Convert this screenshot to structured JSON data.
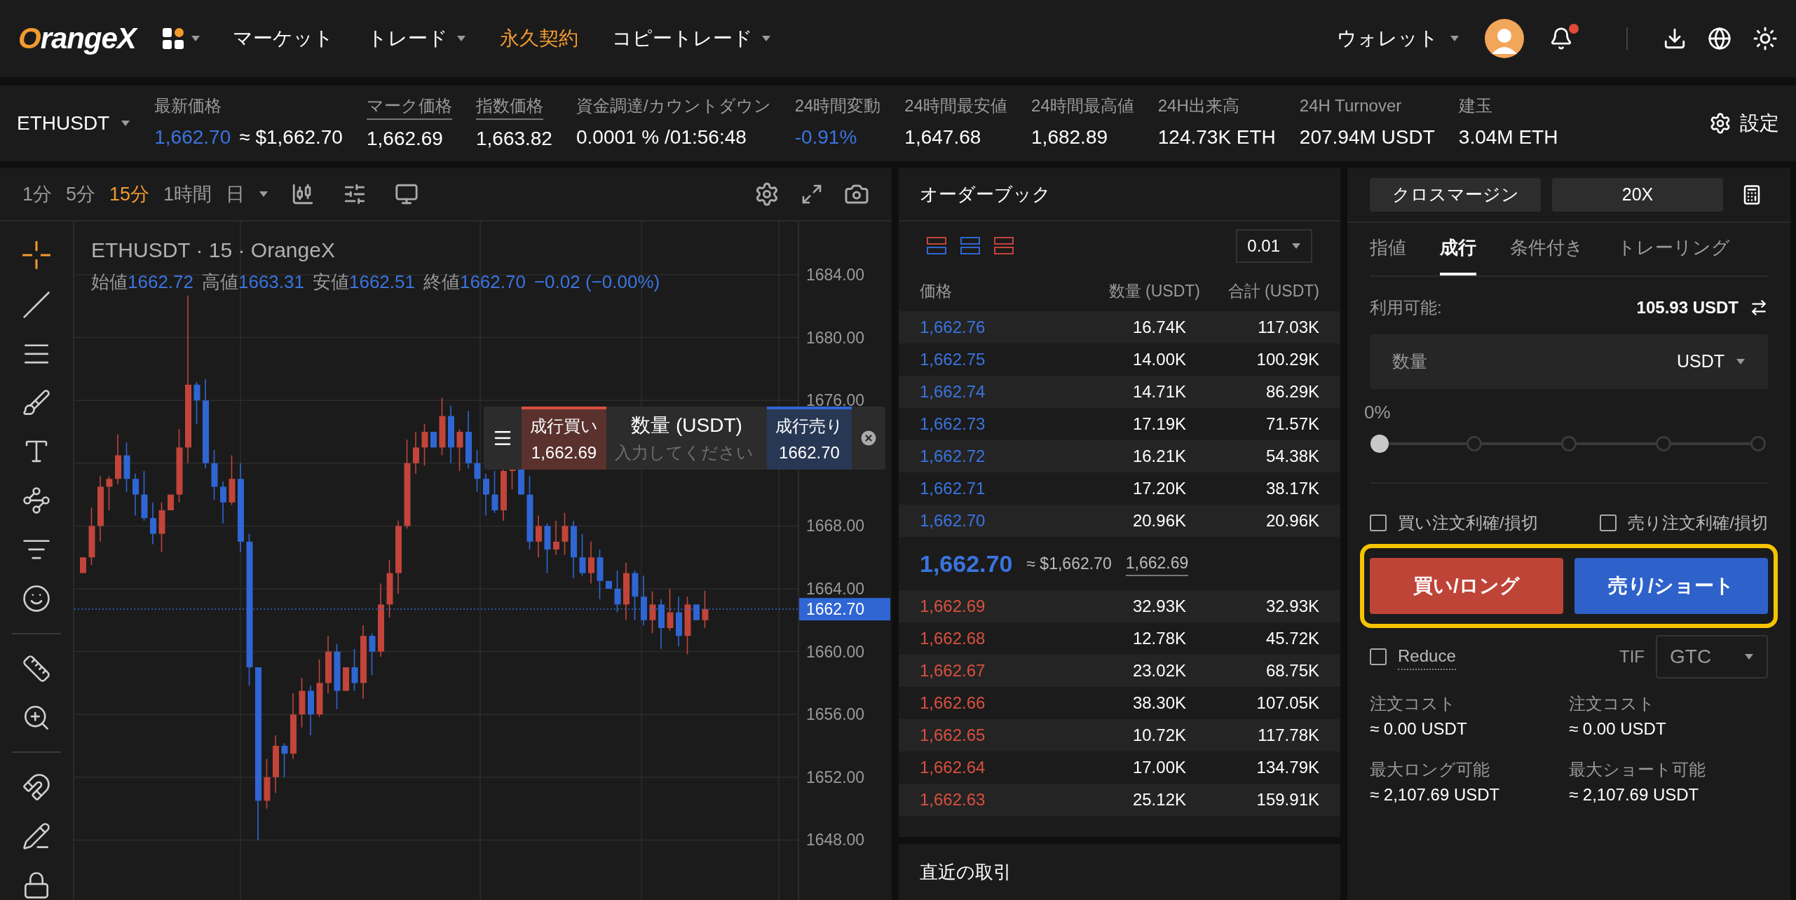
{
  "nav": {
    "logo": "OrangeX",
    "items": [
      {
        "label": "マーケット",
        "dropdown": false,
        "selected": false
      },
      {
        "label": "トレード",
        "dropdown": true,
        "selected": false
      },
      {
        "label": "永久契約",
        "dropdown": false,
        "selected": true
      },
      {
        "label": "コピートレード",
        "dropdown": true,
        "selected": false
      }
    ],
    "wallet": "ウォレット",
    "has_unread": true
  },
  "ticker": {
    "symbol": "ETHUSDT",
    "stats": [
      {
        "label": "最新価格",
        "value": "1,662.70",
        "extra": "≈ $1,662.70",
        "underlined": false,
        "negative": true
      },
      {
        "label": "マーク価格",
        "value": "1,662.69",
        "underlined": true,
        "negative": false
      },
      {
        "label": "指数価格",
        "value": "1,663.82",
        "underlined": true,
        "negative": false
      },
      {
        "label": "資金調達/カウントダウン",
        "value": "0.0001 % /01:56:48",
        "underlined": false,
        "negative": false
      },
      {
        "label": "24時間変動",
        "value": "-0.91%",
        "underlined": false,
        "negative": true
      },
      {
        "label": "24時間最安値",
        "value": "1,647.68",
        "underlined": false,
        "negative": false
      },
      {
        "label": "24時間最高値",
        "value": "1,682.89",
        "underlined": false,
        "negative": false
      },
      {
        "label": "24H出来高",
        "value": "124.73K ETH",
        "underlined": false,
        "negative": false
      },
      {
        "label": "24H Turnover",
        "value": "207.94M USDT",
        "underlined": false,
        "negative": false
      },
      {
        "label": "建玉",
        "value": "3.04M ETH",
        "underlined": false,
        "negative": false
      }
    ],
    "settings": "設定"
  },
  "chart": {
    "intervals": [
      {
        "label": "1分",
        "selected": false
      },
      {
        "label": "5分",
        "selected": false
      },
      {
        "label": "15分",
        "selected": true
      },
      {
        "label": "1時間",
        "selected": false
      },
      {
        "label": "日",
        "selected": false
      }
    ],
    "legend_title": "ETHUSDT · 15 · OrangeX",
    "ohlc": [
      {
        "label": "始値",
        "value": "1662.72"
      },
      {
        "label": "高値",
        "value": "1663.31"
      },
      {
        "label": "安値",
        "value": "1662.51"
      },
      {
        "label": "終値",
        "value": "1662.70"
      }
    ],
    "change": "−0.02 (−0.00%)",
    "price_ticks": [
      "1684.00",
      "1680.00",
      "1676.00",
      "1668.00",
      "1664.00",
      "1660.00",
      "1656.00",
      "1652.00",
      "1648.00"
    ],
    "last_price": "1662.70",
    "quick_order": {
      "buy_label": "成行買い",
      "buy_price": "1,662.69",
      "amount_label": "数量 (USDT)",
      "placeholder": "入力してください",
      "sell_label": "成行売り",
      "sell_price": "1662.70"
    }
  },
  "orderbook": {
    "title": "オーダーブック",
    "precision": "0.01",
    "columns": [
      "価格",
      "数量 (USDT)",
      "合計 (USDT)"
    ],
    "asks": [
      {
        "price": "1,662.76",
        "qty": "16.74K",
        "total": "117.03K"
      },
      {
        "price": "1,662.75",
        "qty": "14.00K",
        "total": "100.29K"
      },
      {
        "price": "1,662.74",
        "qty": "14.71K",
        "total": "86.29K"
      },
      {
        "price": "1,662.73",
        "qty": "17.19K",
        "total": "71.57K"
      },
      {
        "price": "1,662.72",
        "qty": "16.21K",
        "total": "54.38K"
      },
      {
        "price": "1,662.71",
        "qty": "17.20K",
        "total": "38.17K"
      },
      {
        "price": "1,662.70",
        "qty": "20.96K",
        "total": "20.96K"
      }
    ],
    "mid": {
      "price": "1,662.70",
      "usd": "≈ $1,662.70",
      "mark": "1,662.69"
    },
    "bids": [
      {
        "price": "1,662.69",
        "qty": "32.93K",
        "total": "32.93K"
      },
      {
        "price": "1,662.68",
        "qty": "12.78K",
        "total": "45.72K"
      },
      {
        "price": "1,662.67",
        "qty": "23.02K",
        "total": "68.75K"
      },
      {
        "price": "1,662.66",
        "qty": "38.30K",
        "total": "107.05K"
      },
      {
        "price": "1,662.65",
        "qty": "10.72K",
        "total": "117.78K"
      },
      {
        "price": "1,662.64",
        "qty": "17.00K",
        "total": "134.79K"
      },
      {
        "price": "1,662.63",
        "qty": "25.12K",
        "total": "159.91K"
      }
    ],
    "recent_trades": "直近の取引"
  },
  "order": {
    "margin_mode": "クロスマージン",
    "leverage": "20X",
    "tabs": [
      {
        "label": "指値",
        "selected": false
      },
      {
        "label": "成行",
        "selected": true
      },
      {
        "label": "条件付き",
        "selected": false
      },
      {
        "label": "トレーリング",
        "selected": false
      }
    ],
    "available_label": "利用可能:",
    "available_value": "105.93 USDT",
    "amount_label": "数量",
    "amount_unit": "USDT",
    "percent": "0%",
    "slider": {
      "level": 0
    },
    "checkboxes": [
      {
        "label": "買い注文利確/損切",
        "checked": false
      },
      {
        "label": "売り注文利確/損切",
        "checked": false
      }
    ],
    "buy_button": "買い/ロング",
    "sell_button": "売り/ショート",
    "reduce": {
      "label": "Reduce",
      "checked": false
    },
    "tif_label": "TIF",
    "tif_value": "GTC",
    "costs": [
      {
        "label": "注文コスト",
        "value": "≈ 0.00 USDT"
      },
      {
        "label": "注文コスト",
        "value": "≈ 0.00 USDT"
      },
      {
        "label": "最大ロング可能",
        "value": "≈ 2,107.69 USDT"
      },
      {
        "label": "最大ショート可能",
        "value": "≈ 2,107.69 USDT"
      }
    ]
  }
}
